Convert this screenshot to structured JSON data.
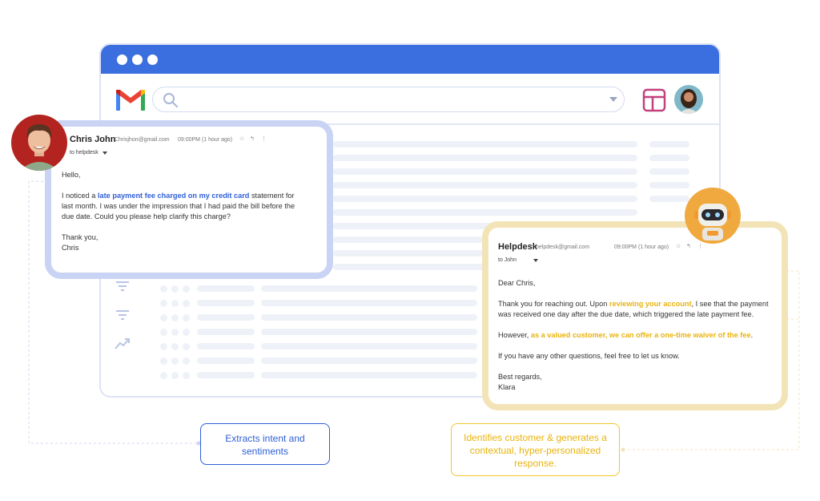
{
  "colors": {
    "titlebar": "#3b6fe0",
    "blue_accent": "#2f5fd6",
    "yellow_accent": "#e9b30c",
    "chris_card_border": "#c9d4f4",
    "help_card_border": "#f3e4b8"
  },
  "icons": [
    "gmail-logo",
    "search-icon",
    "layout-icon",
    "star-icon",
    "reply-icon",
    "more-icon",
    "filter-icon",
    "trend-icon"
  ],
  "customer_email": {
    "sender_name": "Chris John",
    "sender_email": "Chrisjhon@gmail.com",
    "time": "09:00PM (1 hour ago)",
    "to": "to helpdesk",
    "greeting": "Hello,",
    "body_before": "I noticed a ",
    "body_highlight": "late payment fee charged on my credit card",
    "body_after": " statement for last month. I was under the impression that I had paid the bill before the due date. Could you please help clarify this charge?",
    "closing": "Thank you,",
    "signature": "Chris"
  },
  "reply_email": {
    "sender_name": "Helpdesk",
    "sender_email": "helpdesk@gmail.com",
    "time": "09:00PM (1 hour ago)",
    "to": "to John",
    "greeting": "Dear Chris,",
    "p1_before": "Thank you for reaching out. Upon ",
    "p1_highlight": "reviewing your account",
    "p1_after": ", I see that the payment was received one day after the due date, which triggered the late payment fee.",
    "p2_before": "However, ",
    "p2_highlight": "as a valued customer, we can offer a one-time waiver of the fee",
    "p2_after": ".",
    "p3": "If you have any other questions, feel free to let us know.",
    "closing": "Best regards,",
    "signature": "Klara"
  },
  "callouts": {
    "intent": "Extracts intent and sentiments",
    "response": "Identifies customer & generates a contextual, hyper-personalized response."
  }
}
